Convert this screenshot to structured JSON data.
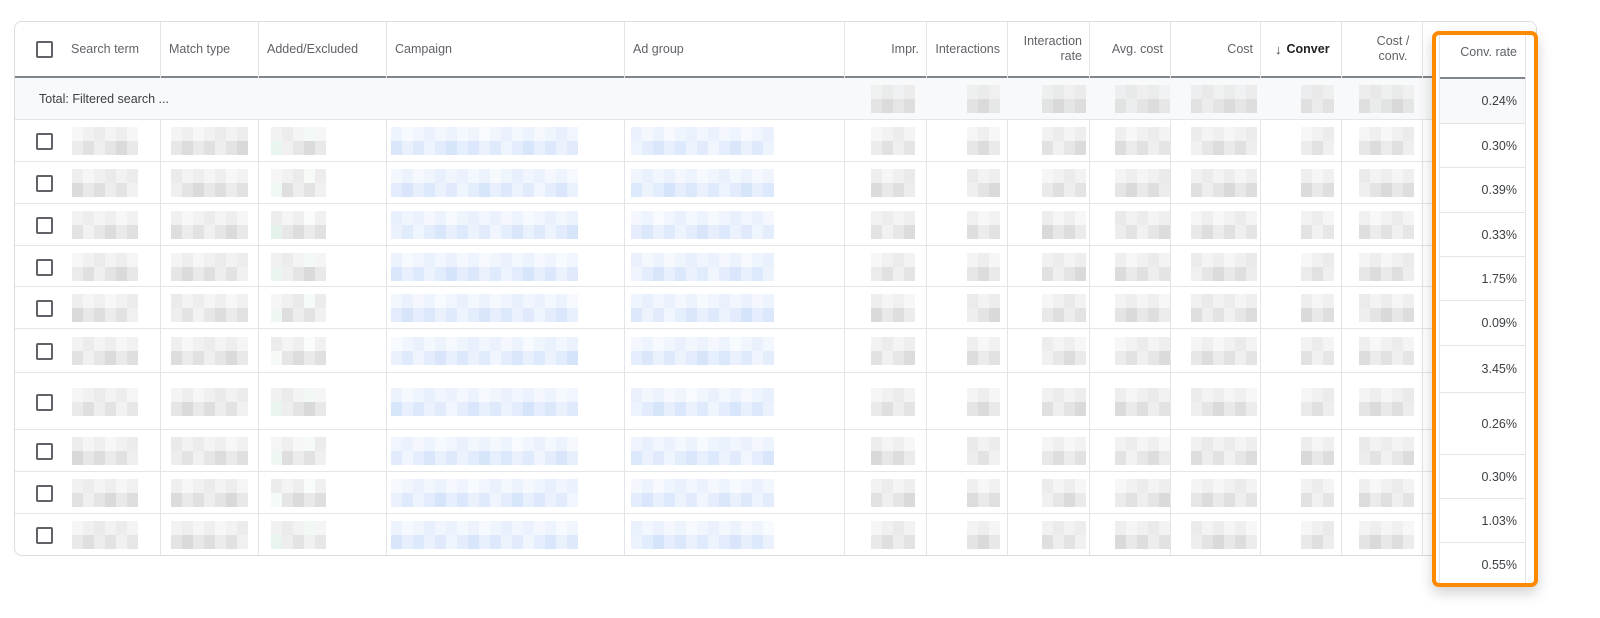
{
  "table": {
    "columns": [
      {
        "key": "select",
        "label": ""
      },
      {
        "key": "search_term",
        "label": "Search term"
      },
      {
        "key": "match_type",
        "label": "Match type"
      },
      {
        "key": "added_excluded",
        "label": "Added/Excluded"
      },
      {
        "key": "campaign",
        "label": "Campaign"
      },
      {
        "key": "ad_group",
        "label": "Ad group"
      },
      {
        "key": "impr",
        "label": "Impr."
      },
      {
        "key": "interactions",
        "label": "Interactions"
      },
      {
        "key": "interaction_rate",
        "label": "Interaction rate"
      },
      {
        "key": "avg_cost",
        "label": "Avg. cost"
      },
      {
        "key": "cost",
        "label": "Cost"
      },
      {
        "key": "conversions",
        "label": "Conver",
        "sorted": "descending"
      },
      {
        "key": "cost_per_conv",
        "label": "Cost / conv."
      },
      {
        "key": "conv_rate",
        "label": "Conv. rate"
      }
    ],
    "total_row": {
      "label": "Total: Filtered search ...",
      "conv_rate": "0.24%"
    },
    "rows": [
      {
        "conv_rate": "0.30%",
        "redacted": true
      },
      {
        "conv_rate": "0.39%",
        "redacted": true
      },
      {
        "conv_rate": "0.33%",
        "redacted": true
      },
      {
        "conv_rate": "1.75%",
        "redacted": true
      },
      {
        "conv_rate": "0.09%",
        "redacted": true
      },
      {
        "conv_rate": "3.45%",
        "redacted": true
      },
      {
        "conv_rate": "0.26%",
        "redacted": true
      },
      {
        "conv_rate": "0.30%",
        "redacted": true
      },
      {
        "conv_rate": "1.03%",
        "redacted": true
      },
      {
        "conv_rate": "0.55%",
        "redacted": true
      }
    ]
  },
  "highlight": {
    "column": "Conv. rate",
    "color": "#ff8a00"
  },
  "icons": {
    "sort": "arrow-down-icon",
    "select": "checkbox-icon"
  },
  "colors": {
    "redacted_gray": "#d9d9d9",
    "redacted_blue": "#d6e4fb",
    "redacted_green": "#e3f2ea",
    "header_rule": "#80868b"
  }
}
